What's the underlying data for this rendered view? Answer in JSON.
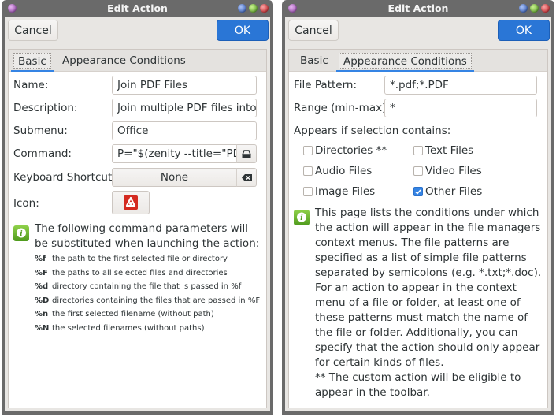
{
  "windows": [
    {
      "title": "Edit Action",
      "buttons": {
        "cancel": "Cancel",
        "ok": "OK"
      },
      "tabs": [
        {
          "label": "Basic",
          "active": true
        },
        {
          "label": "Appearance Conditions",
          "active": false
        }
      ],
      "basic": {
        "name_label": "Name:",
        "name_value": "Join PDF Files",
        "description_label": "Description:",
        "description_value": "Join multiple PDF files into c",
        "submenu_label": "Submenu:",
        "submenu_value": "Office",
        "command_label": "Command:",
        "command_value": "P=\"$(zenity --title=\"PDF J",
        "shortcut_label": "Keyboard Shortcut:",
        "shortcut_value": "None",
        "icon_label": "Icon:",
        "info_text": "The following command parameters will be substituted when launching the action:",
        "params": [
          {
            "code": "%f",
            "desc": "the path to the first selected file or directory"
          },
          {
            "code": "%F",
            "desc": "the paths to all selected files and directories"
          },
          {
            "code": "%d",
            "desc": "directory containing the file that is passed in %f"
          },
          {
            "code": "%D",
            "desc": "directories containing the files that are passed in %F"
          },
          {
            "code": "%n",
            "desc": "the first selected filename (without path)"
          },
          {
            "code": "%N",
            "desc": "the selected filenames (without paths)"
          }
        ]
      }
    },
    {
      "title": "Edit Action",
      "buttons": {
        "cancel": "Cancel",
        "ok": "OK"
      },
      "tabs": [
        {
          "label": "Basic",
          "active": false
        },
        {
          "label": "Appearance Conditions",
          "active": true
        }
      ],
      "conditions": {
        "pattern_label": "File Pattern:",
        "pattern_value": "*.pdf;*.PDF",
        "range_label": "Range (min-max):",
        "range_value": "*",
        "appears_label": "Appears if selection contains:",
        "checkboxes": [
          {
            "label": "Directories **",
            "checked": false
          },
          {
            "label": "Text Files",
            "checked": false
          },
          {
            "label": "Audio Files",
            "checked": false
          },
          {
            "label": "Video Files",
            "checked": false
          },
          {
            "label": "Image Files",
            "checked": false
          },
          {
            "label": "Other Files",
            "checked": true
          }
        ],
        "info_text": "This page lists the conditions under which the action will appear in the file managers context menus. The file patterns are specified as a list of simple file patterns separated by semicolons (e.g. *.txt;*.doc). For an action to appear in the context menu of a file or folder, at least one of these patterns must match the name of the file or folder. Additionally, you can specify that the action should only appear for certain kinds of files.",
        "info_note": "** The custom action will be eligible to appear in the toolbar."
      }
    }
  ],
  "colors": {
    "accent": "#3584e4",
    "ok_button": "#2a76d6",
    "titlebar": "#6a6a6a"
  }
}
